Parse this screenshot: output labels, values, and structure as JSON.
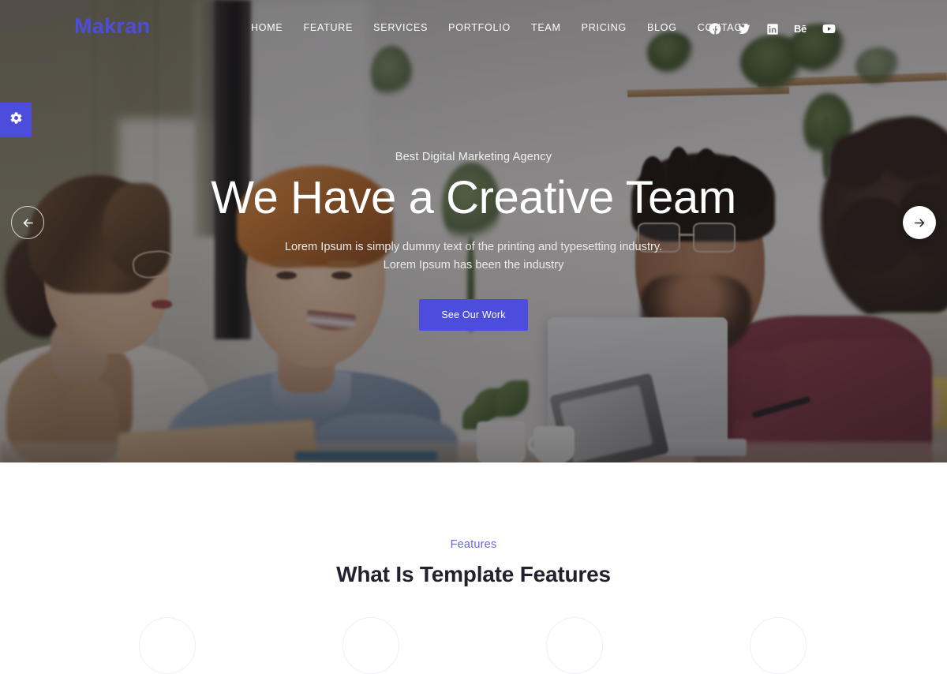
{
  "header": {
    "logo": "Makran",
    "nav": [
      {
        "label": "HOME"
      },
      {
        "label": "FEATURE"
      },
      {
        "label": "SERVICES"
      },
      {
        "label": "PORTFOLIO"
      },
      {
        "label": "TEAM"
      },
      {
        "label": "PRICING"
      },
      {
        "label": "BLOG"
      },
      {
        "label": "CONTACT"
      }
    ],
    "socials": [
      {
        "name": "facebook",
        "glyph": "f"
      },
      {
        "name": "twitter",
        "glyph": "t"
      },
      {
        "name": "linkedin",
        "glyph": "in"
      },
      {
        "name": "behance",
        "glyph": "Bē"
      },
      {
        "name": "youtube",
        "glyph": "▶"
      }
    ]
  },
  "settings_tab": {
    "icon": "gear-icon"
  },
  "hero": {
    "subtitle": "Best Digital Marketing Agency",
    "title": "We Have a Creative Team",
    "description": "Lorem Ipsum is simply dummy text of the printing and typesetting industry. Lorem Ipsum has been the industry",
    "description_line1": "Lorem Ipsum is simply dummy text of the printing and typesetting industry.",
    "description_line2": "Lorem Ipsum has been the industry",
    "cta_label": "See Our Work",
    "prev_arrow": "←",
    "next_arrow": "→"
  },
  "features": {
    "eyebrow": "Features",
    "title": "What Is Template Features",
    "circle_count": 4
  },
  "colors": {
    "accent": "#4d4ddd",
    "eyebrow": "#6a63e8",
    "heading": "#23212b",
    "hero_text": "#ffffff",
    "page_bg": "#ffffff"
  }
}
